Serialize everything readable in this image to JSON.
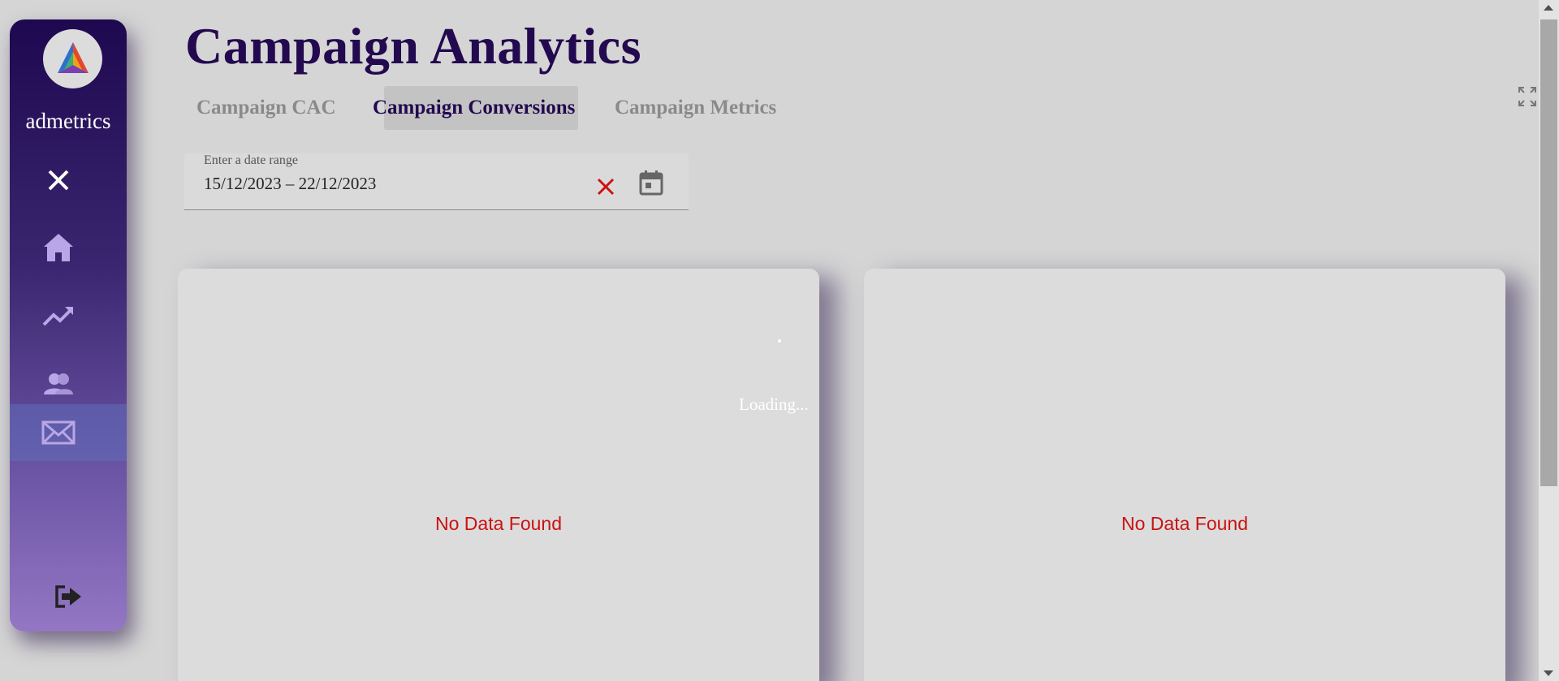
{
  "app": {
    "brand": "admetrics",
    "title": "Campaign Analytics"
  },
  "sidebar": {
    "items": [
      {
        "icon": "close-icon"
      },
      {
        "icon": "home-icon"
      },
      {
        "icon": "trending-up-icon"
      },
      {
        "icon": "people-icon"
      },
      {
        "icon": "mail-icon",
        "active": true
      },
      {
        "icon": "logout-icon"
      }
    ]
  },
  "tabs": [
    {
      "label": "Campaign CAC"
    },
    {
      "label": "Campaign Conversions",
      "active": true
    },
    {
      "label": "Campaign Metrics"
    }
  ],
  "date_range": {
    "label": "Enter a date range",
    "value": "15/12/2023 – 22/12/2023"
  },
  "cards": [
    {
      "message": "No Data Found"
    },
    {
      "message": "No Data Found"
    }
  ],
  "loading_text": "Loading...",
  "colors": {
    "title": "#23094f",
    "error": "#cc1111",
    "sidebar_top": "#1e0850",
    "sidebar_bottom": "#9377c4"
  }
}
